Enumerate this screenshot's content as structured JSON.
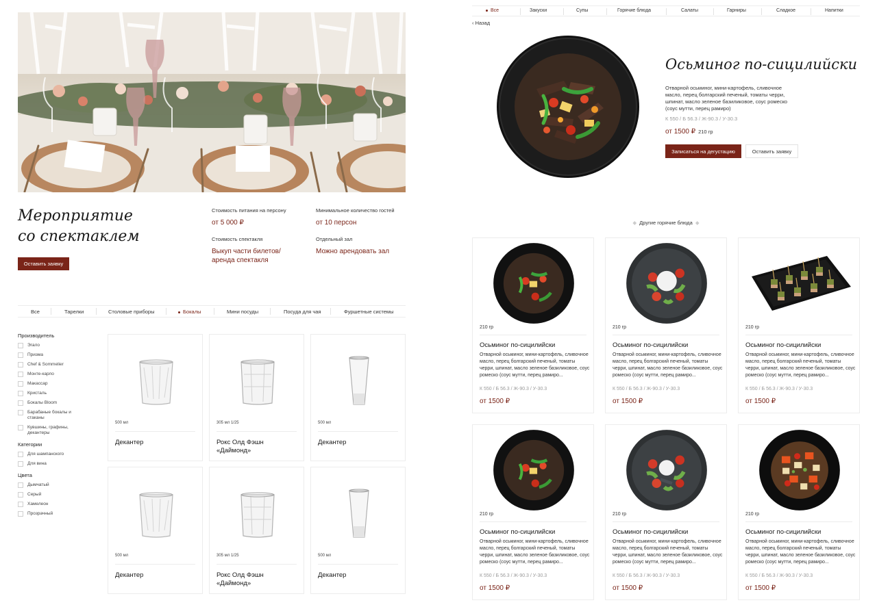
{
  "event": {
    "title_line1": "Мероприятие",
    "title_line2": "со спектаклем",
    "cta": "Оставить заявку",
    "info": [
      {
        "label": "Стоимость питания на персону",
        "value": "от 5 000 ₽"
      },
      {
        "label": "Минимальное количество гостей",
        "value": "от 10 персон"
      },
      {
        "label": "Стоимость спектакля",
        "value": "Выкуп части билетов/ аренда спектакля"
      },
      {
        "label": "Отдельный зал",
        "value": "Можно арендовать зал"
      }
    ]
  },
  "catalog_tabs": [
    "Все",
    "Тарелки",
    "Столовые приборы",
    "Бокалы",
    "Мини посуды",
    "Посуда для чая",
    "Фуршетные системы"
  ],
  "catalog_active_tab": "Бокалы",
  "filters": {
    "manufacturer_title": "Производитель",
    "manufacturers": [
      "Эгало",
      "Призма",
      "Chef & Sommelier",
      "Монте-карло",
      "Макассар",
      "Кристаль",
      "Бокалы Bloom",
      "Барабаные бокалы и стаканы",
      "Кувшины, графины, декантеры"
    ],
    "category_title": "Категории",
    "categories": [
      "Для шампанского",
      "Для вина"
    ],
    "color_title": "Цвета",
    "colors": [
      "Дымчатый",
      "Серый",
      "Хамелеон",
      "Прозрачный"
    ]
  },
  "products": [
    {
      "volume": "500 мл",
      "name": "Декантер",
      "icon": "tumbler-glass-icon"
    },
    {
      "volume": "305 мл 1/25",
      "name": "Рокс Олд Фэшн «Даймонд»",
      "icon": "rocks-glass-icon"
    },
    {
      "volume": "500 мл",
      "name": "Декантер",
      "icon": "shot-glass-icon"
    },
    {
      "volume": "500 мл",
      "name": "Декантер",
      "icon": "tumbler-glass-icon"
    },
    {
      "volume": "305 мл 1/25",
      "name": "Рокс Олд Фэшн «Даймонд»",
      "icon": "rocks-glass-icon"
    },
    {
      "volume": "500 мл",
      "name": "Декантер",
      "icon": "shot-glass-icon"
    }
  ],
  "menu_tabs": [
    "Все",
    "Закуски",
    "Супы",
    "Горячие блюда",
    "Салаты",
    "Гарниры",
    "Сладкое",
    "Напитки"
  ],
  "menu_active_tab": "Все",
  "dish": {
    "back": "Назад",
    "name": "Осьминог по-сицилийски",
    "description": "Отварной осьминог, мини-картофель, сливочное масло, перец болгарский печеный, томаты черри, шпинат, масло зеленое базиликовое, соус ромеско (соус мутти, перец рамиро)",
    "nutrition": "К 550 / Б 56.3 / Ж-90.3 / У-30.3",
    "price": "от 1500 ₽",
    "weight": "210 гр",
    "btn_tasting": "Записаться на дегустацию",
    "btn_request": "Оставить заявку"
  },
  "other_title": "Другие горячие блюда",
  "other_dishes": [
    {
      "weight": "210 гр",
      "name": "Осьминог по-сицилийски",
      "desc": "Отварной осьминог, мини-картофель, сливочное масло, перец болгарский печеный, томаты черри, шпинат, масло зеленое базиликовое, соус ромеско (соус мутти, перец рамиро...",
      "nutrition": "К 550 / Б 56.3 / Ж-90.3 / У-30.3",
      "price": "от 1500 ₽",
      "icon": "black-plate-stirfry-icon"
    },
    {
      "weight": "210 гр",
      "name": "Осьминог по-сицилийски",
      "desc": "Отварной осьминог, мини-картофель, сливочное масло, перец болгарский печеный, томаты черри, шпинат, масло зеленое базиликовое, соус ромеско (соус мутти, перец рамиро...",
      "nutrition": "К 550 / Б 56.3 / Ж-90.3 / У-30.3",
      "price": "от 1500 ₽",
      "icon": "stone-plate-salad-icon"
    },
    {
      "weight": "210 гр",
      "name": "Осьминог по-сицилийски",
      "desc": "Отварной осьминог, мини-картофель, сливочное масло, перец болгарский печеный, томаты черри, шпинат, масло зеленое базиликовое, соус ромеско (соус мутти, перец рамиро...",
      "nutrition": "К 550 / Б 56.3 / Ж-90.3 / У-30.3",
      "price": "от 1500 ₽",
      "icon": "canape-tray-icon"
    },
    {
      "weight": "210 гр",
      "name": "Осьминог по-сицилийски",
      "desc": "Отварной осьминог, мини-картофель, сливочное масло, перец болгарский печеный, томаты черри, шпинат, масло зеленое базиликовое, соус ромеско (соус мутти, перец рамиро...",
      "nutrition": "К 550 / Б 56.3 / Ж-90.3 / У-30.3",
      "price": "от 1500 ₽",
      "icon": "black-plate-stirfry-icon"
    },
    {
      "weight": "210 гр",
      "name": "Осьминог по-сицилийски",
      "desc": "Отварной осьминог, мини-картофель, сливочное масло, перец болгарский печеный, томаты черри, шпинат, масло зеленое базиликовое, соус ромеско (соус мутти, перец рамиро...",
      "nutrition": "К 550 / Б 56.3 / Ж-90.3 / У-30.3",
      "price": "от 1500 ₽",
      "icon": "stone-plate-salad-icon"
    },
    {
      "weight": "210 гр",
      "name": "Осьминог по-сицилийски",
      "desc": "Отварной осьминог, мини-картофель, сливочное масло, перец болгарский печеный, томаты черри, шпинат, масло зеленое базиликовое, соус ромеско (соус мутти, перец рамиро...",
      "nutrition": "К 550 / Б 56.3 / Ж-90.3 / У-30.3",
      "price": "от 1500 ₽",
      "icon": "black-plate-vegetables-icon"
    }
  ],
  "colors": {
    "accent": "#7a2418",
    "border": "#ececec",
    "text": "#1a1a1a"
  }
}
